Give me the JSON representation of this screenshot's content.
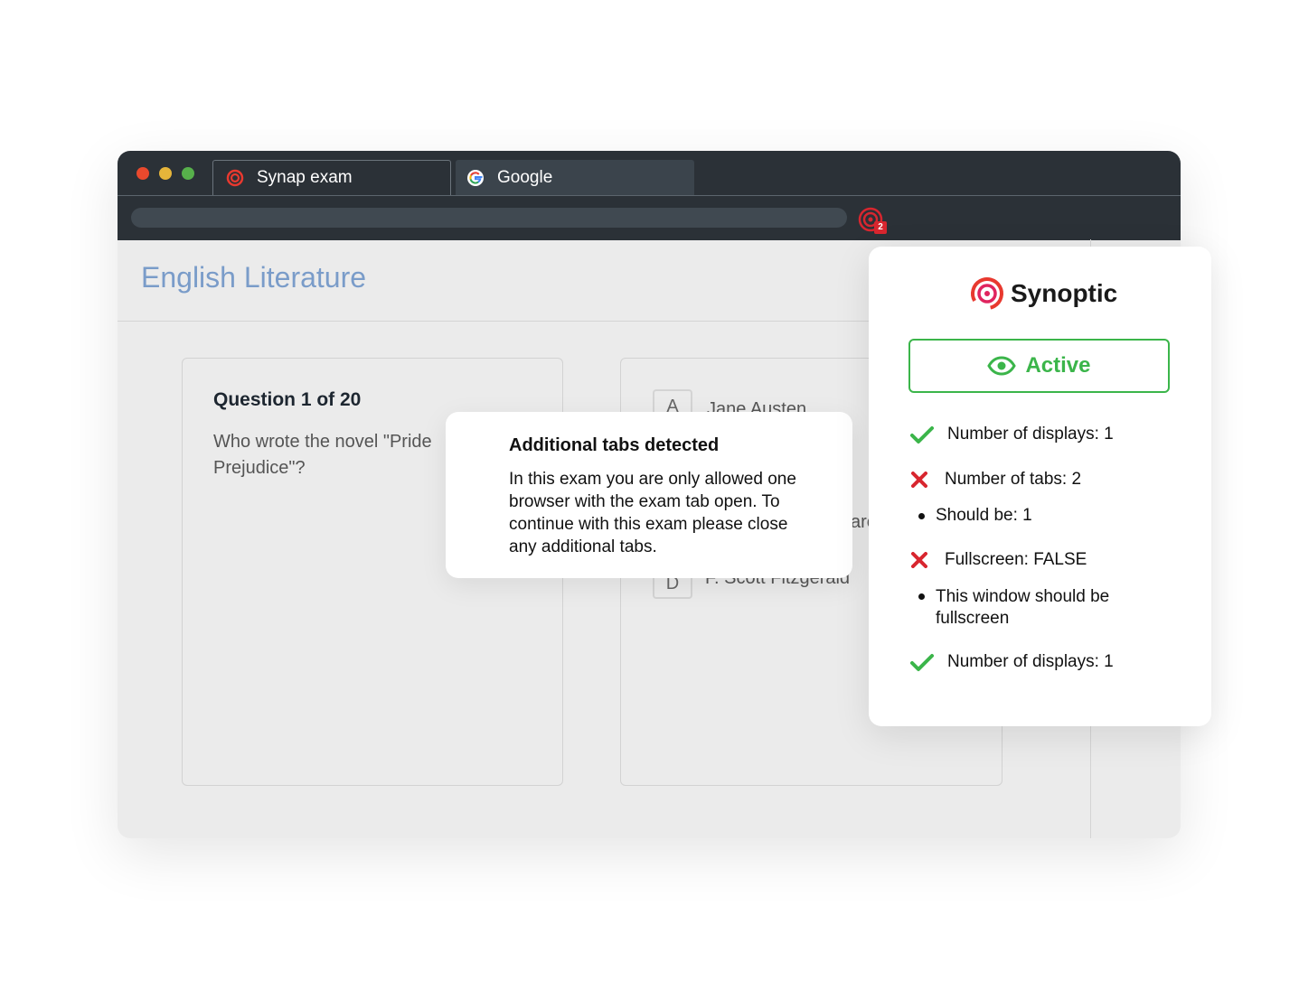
{
  "browser": {
    "tabs": [
      {
        "label": "Synap exam",
        "icon": "synap-logo-icon",
        "active": true
      },
      {
        "label": "Google",
        "icon": "google-icon",
        "active": false
      }
    ],
    "extension_badge": "2",
    "window_controls": {
      "close": "#e9492d",
      "minimize": "#e6b53a",
      "maximize": "#57b04b"
    }
  },
  "page": {
    "title": "English Literature",
    "question": {
      "label": "Question 1 of 20",
      "text": "Who wrote the novel \"Pride Prejudice\"?"
    },
    "options": [
      {
        "letter": "A",
        "text": "Jane Austen"
      },
      {
        "letter": "D",
        "text": "F. Scott Fitzgerald"
      }
    ],
    "partial_option_text": "are"
  },
  "alert": {
    "title": "Additional tabs detected",
    "body": "In this exam you are only allowed one browser with the exam tab open. To continue with this exam please close any additional tabs."
  },
  "panel": {
    "brand": "Synoptic",
    "status_label": "Active",
    "checks": [
      {
        "status": "pass",
        "label": "Number of displays: 1"
      },
      {
        "status": "fail",
        "label": "Number of tabs: 2"
      },
      {
        "status": "detail",
        "label": "Should be: 1"
      },
      {
        "status": "fail",
        "label": "Fullscreen: FALSE"
      },
      {
        "status": "detail",
        "label": "This window should be fullscreen"
      },
      {
        "status": "pass",
        "label": "Number of displays: 1"
      }
    ],
    "colors": {
      "pass": "#3bb54a",
      "fail": "#d8262f",
      "accent": "#3bb54a",
      "brand": "#e8392f"
    }
  }
}
